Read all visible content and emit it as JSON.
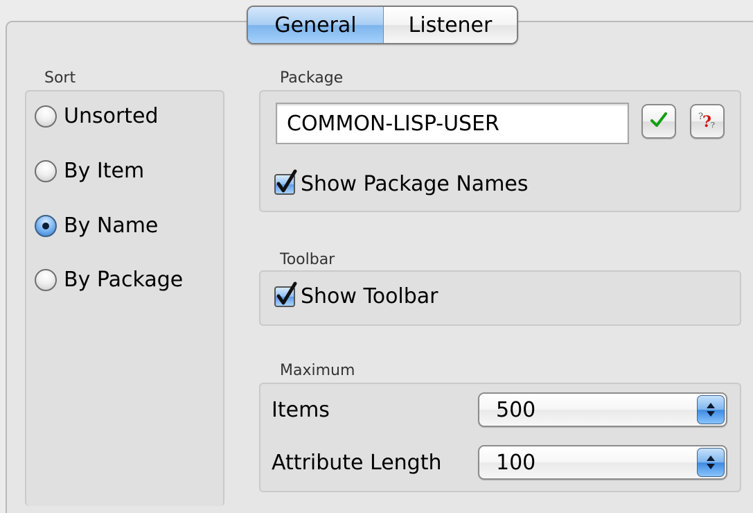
{
  "tabs": [
    {
      "label": "General",
      "active": true
    },
    {
      "label": "Listener",
      "active": false
    }
  ],
  "sort": {
    "label": "Sort",
    "options": [
      {
        "label": "Unsorted",
        "selected": false
      },
      {
        "label": "By Item",
        "selected": false
      },
      {
        "label": "By Name",
        "selected": true
      },
      {
        "label": "By Package",
        "selected": false
      }
    ]
  },
  "package": {
    "label": "Package",
    "value": "COMMON-LISP-USER",
    "show_names_label": "Show Package Names",
    "show_names_checked": true,
    "confirm_icon": "checkmark-icon",
    "help_icon": "question-mark-icon"
  },
  "toolbar": {
    "label": "Toolbar",
    "show_label": "Show Toolbar",
    "show_checked": true
  },
  "maximum": {
    "label": "Maximum",
    "items_label": "Items",
    "items_value": "500",
    "attr_label": "Attribute Length",
    "attr_value": "100"
  },
  "colors": {
    "background": "#ececec",
    "group_box": "#e0e0e0",
    "accent_blue": "#7db4ec",
    "check_green": "#12a012",
    "help_red": "#d01010"
  }
}
